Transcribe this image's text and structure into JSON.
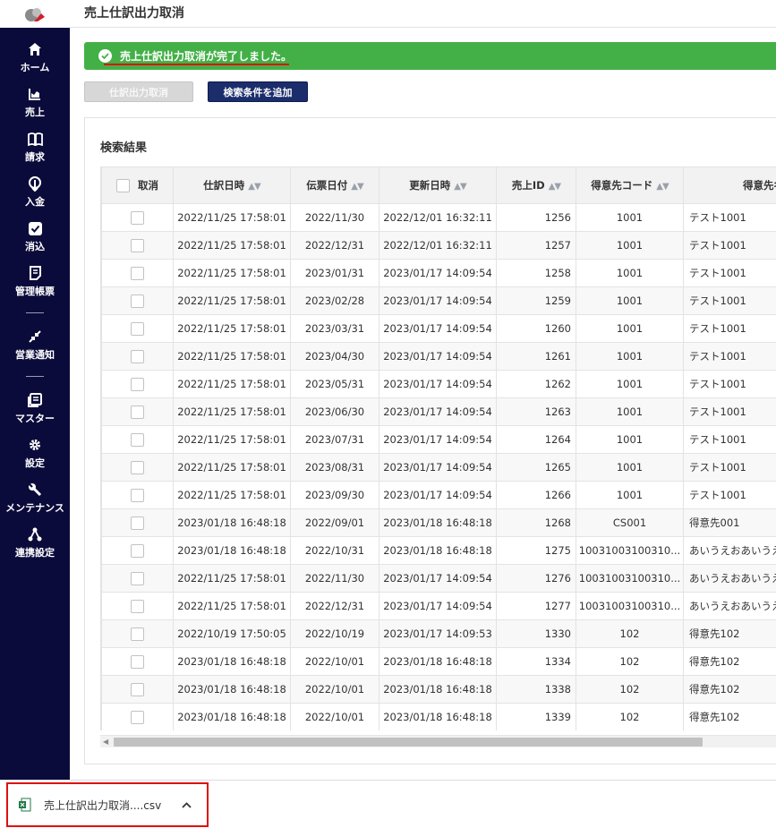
{
  "page_title": "売上仕訳出力取消",
  "sidebar": {
    "items": [
      {
        "label": "ホーム",
        "icon": "home-icon"
      },
      {
        "label": "売上",
        "icon": "sales-icon"
      },
      {
        "label": "請求",
        "icon": "book-icon"
      },
      {
        "label": "入金",
        "icon": "deposit-icon"
      },
      {
        "label": "消込",
        "icon": "check-icon"
      },
      {
        "label": "管理帳票",
        "icon": "report-icon"
      },
      {
        "label": "営業通知",
        "icon": "notification-icon"
      },
      {
        "label": "マスター",
        "icon": "master-icon"
      },
      {
        "label": "設定",
        "icon": "gear-icon"
      },
      {
        "label": "メンテナンス",
        "icon": "wrench-icon"
      },
      {
        "label": "連携設定",
        "icon": "network-icon"
      }
    ],
    "bg_color": "#0b0b3b"
  },
  "alert": {
    "message": "売上仕訳出力取消が完了しました。",
    "color": "#43b047"
  },
  "buttons": {
    "cancel_output": "仕訳出力取消",
    "add_search_condition": "検索条件を追加"
  },
  "results": {
    "title": "検索結果",
    "columns": [
      "取消",
      "仕訳日時",
      "伝票日付",
      "更新日時",
      "売上ID",
      "得意先コード",
      "得意先名"
    ],
    "rows": [
      [
        "2022/11/25 17:58:01",
        "2022/11/30",
        "2022/12/01 16:32:11",
        "1256",
        "1001",
        "テスト1001"
      ],
      [
        "2022/11/25 17:58:01",
        "2022/12/31",
        "2022/12/01 16:32:11",
        "1257",
        "1001",
        "テスト1001"
      ],
      [
        "2022/11/25 17:58:01",
        "2023/01/31",
        "2023/01/17 14:09:54",
        "1258",
        "1001",
        "テスト1001"
      ],
      [
        "2022/11/25 17:58:01",
        "2023/02/28",
        "2023/01/17 14:09:54",
        "1259",
        "1001",
        "テスト1001"
      ],
      [
        "2022/11/25 17:58:01",
        "2023/03/31",
        "2023/01/17 14:09:54",
        "1260",
        "1001",
        "テスト1001"
      ],
      [
        "2022/11/25 17:58:01",
        "2023/04/30",
        "2023/01/17 14:09:54",
        "1261",
        "1001",
        "テスト1001"
      ],
      [
        "2022/11/25 17:58:01",
        "2023/05/31",
        "2023/01/17 14:09:54",
        "1262",
        "1001",
        "テスト1001"
      ],
      [
        "2022/11/25 17:58:01",
        "2023/06/30",
        "2023/01/17 14:09:54",
        "1263",
        "1001",
        "テスト1001"
      ],
      [
        "2022/11/25 17:58:01",
        "2023/07/31",
        "2023/01/17 14:09:54",
        "1264",
        "1001",
        "テスト1001"
      ],
      [
        "2022/11/25 17:58:01",
        "2023/08/31",
        "2023/01/17 14:09:54",
        "1265",
        "1001",
        "テスト1001"
      ],
      [
        "2022/11/25 17:58:01",
        "2023/09/30",
        "2023/01/17 14:09:54",
        "1266",
        "1001",
        "テスト1001"
      ],
      [
        "2023/01/18 16:48:18",
        "2022/09/01",
        "2023/01/18 16:48:18",
        "1268",
        "CS001",
        "得意先001"
      ],
      [
        "2023/01/18 16:48:18",
        "2022/10/31",
        "2023/01/18 16:48:18",
        "1275",
        "10031003100310...",
        "あいうえおあいうえ"
      ],
      [
        "2022/11/25 17:58:01",
        "2022/11/30",
        "2023/01/17 14:09:54",
        "1276",
        "10031003100310...",
        "あいうえおあいうえ"
      ],
      [
        "2022/11/25 17:58:01",
        "2022/12/31",
        "2023/01/17 14:09:54",
        "1277",
        "10031003100310...",
        "あいうえおあいうえ"
      ],
      [
        "2022/10/19 17:50:05",
        "2022/10/19",
        "2023/01/17 14:09:53",
        "1330",
        "102",
        "得意先102"
      ],
      [
        "2023/01/18 16:48:18",
        "2022/10/01",
        "2023/01/18 16:48:18",
        "1334",
        "102",
        "得意先102"
      ],
      [
        "2023/01/18 16:48:18",
        "2022/10/01",
        "2023/01/18 16:48:18",
        "1338",
        "102",
        "得意先102"
      ],
      [
        "2023/01/18 16:48:18",
        "2022/10/01",
        "2023/01/18 16:48:18",
        "1339",
        "102",
        "得意先102"
      ],
      [
        "",
        "",
        "",
        "",
        "",
        ""
      ]
    ]
  },
  "download": {
    "file_name": "売上仕訳出力取消....csv",
    "icon": "excel-file-icon"
  }
}
